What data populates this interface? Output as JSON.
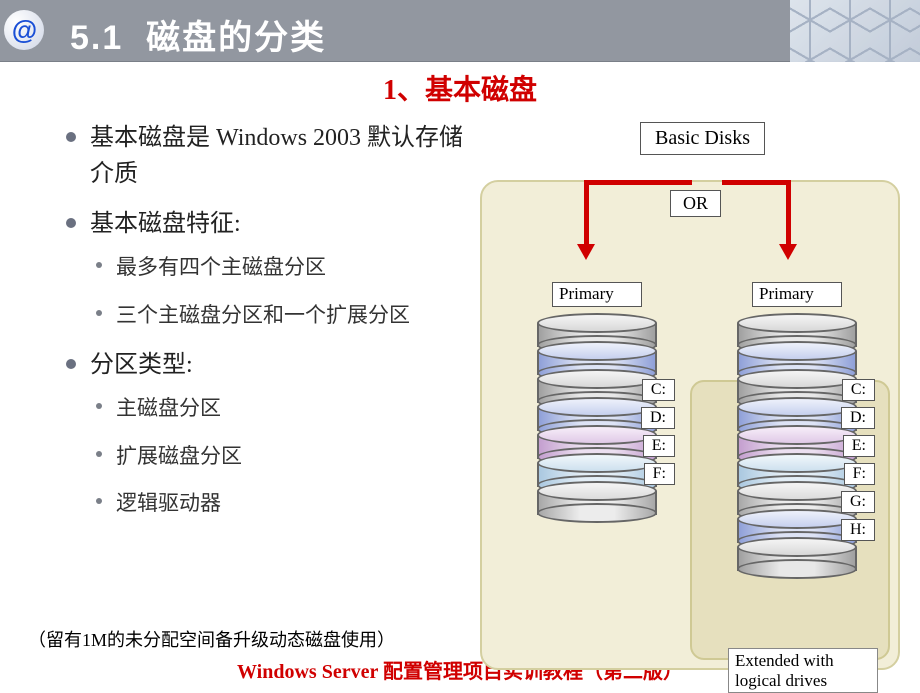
{
  "header": {
    "section_no": "5.1",
    "section_title": "磁盘的分类"
  },
  "subtitle": "1、基本磁盘",
  "bullets": {
    "b1": "基本磁盘是 Windows 2003 默认存储介质",
    "b2": "基本磁盘特征:",
    "b2_sub": [
      "最多有四个主磁盘分区",
      "三个主磁盘分区和一个扩展分区"
    ],
    "b3": "分区类型:",
    "b3_sub": [
      "主磁盘分区",
      "扩展磁盘分区",
      "逻辑驱动器"
    ]
  },
  "footnote": "（留有1M的未分配空间备升级动态磁盘使用）",
  "footer": "Windows Server 配置管理项目实训教程（第二版）",
  "diagram": {
    "basic_label": "Basic Disks",
    "or_label": "OR",
    "primary_label": "Primary",
    "extended_label": "Extended with logical drives",
    "left_drives": [
      "C:",
      "D:",
      "E:",
      "F:"
    ],
    "right_drives": [
      "C:",
      "D:",
      "E:",
      "F:",
      "G:",
      "H:"
    ]
  }
}
